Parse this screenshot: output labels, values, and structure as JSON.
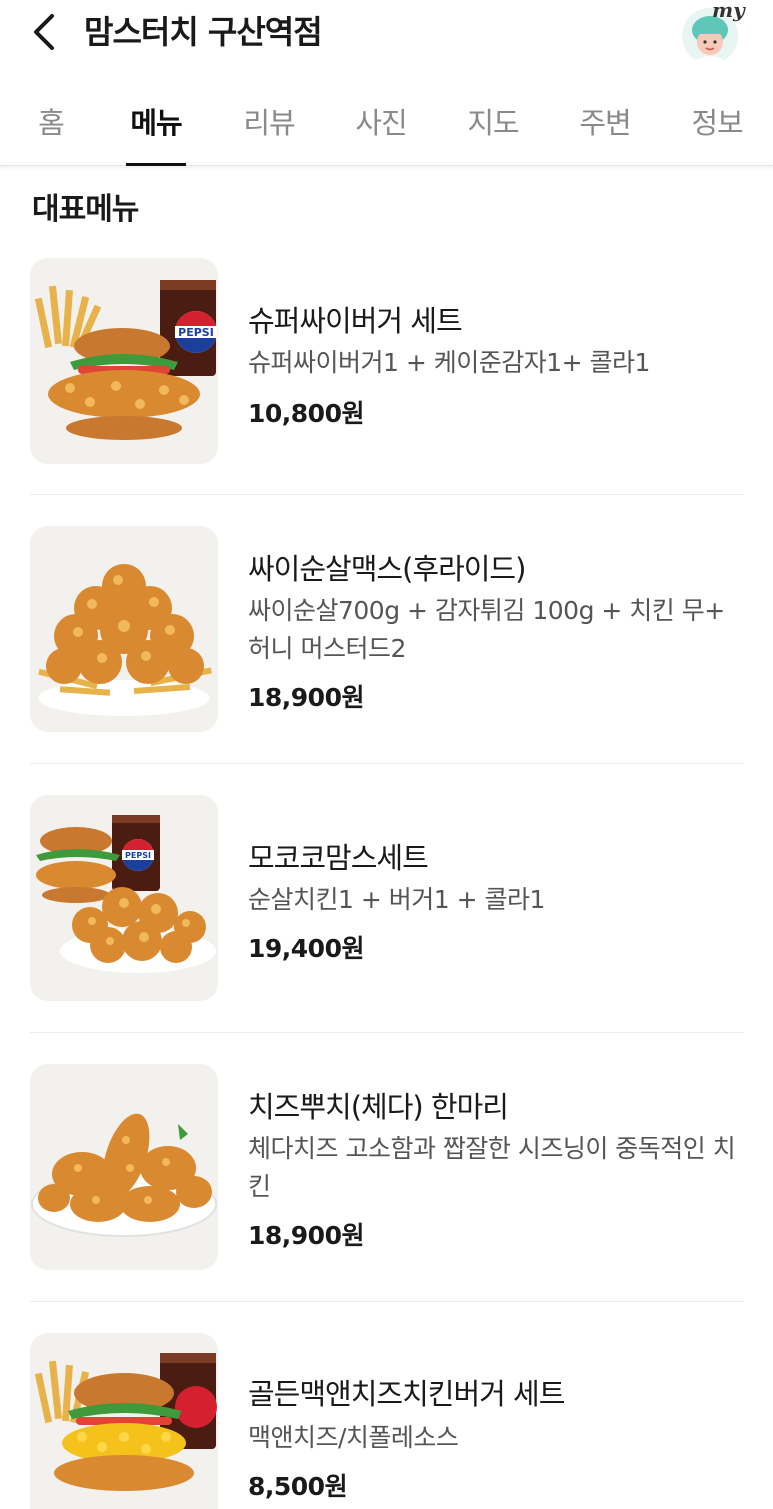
{
  "header": {
    "title": "맘스터치 구산역점",
    "avatar_badge": "my"
  },
  "tabs": [
    {
      "label": "홈",
      "active": false
    },
    {
      "label": "메뉴",
      "active": true
    },
    {
      "label": "리뷰",
      "active": false
    },
    {
      "label": "사진",
      "active": false
    },
    {
      "label": "지도",
      "active": false
    },
    {
      "label": "주변",
      "active": false
    },
    {
      "label": "정보",
      "active": false
    }
  ],
  "section_title": "대표메뉴",
  "menu": [
    {
      "name": "슈퍼싸이버거 세트",
      "desc": "슈퍼싸이버거1 + 케이준감자1+ 콜라1",
      "price": "10,800원",
      "image": "burger-set-image"
    },
    {
      "name": "싸이순살맥스(후라이드)",
      "desc": "싸이순살700g + 감자튀김 100g + 치킨 무+ 허니 머스터드2",
      "price": "18,900원",
      "image": "chicken-fries-image"
    },
    {
      "name": "모코코맘스세트",
      "desc": "순살치킨1 + 버거1 + 콜라1",
      "price": "19,400원",
      "image": "chicken-burger-set-image"
    },
    {
      "name": "치즈뿌치(체다) 한마리",
      "desc": "체다치즈 고소함과 짭잘한 시즈닝이 중독적인 치킨",
      "price": "18,900원",
      "image": "fried-chicken-plate-image"
    },
    {
      "name": "골든맥앤치즈치킨버거 세트",
      "desc": "맥앤치즈/치폴레소스",
      "price": "8,500원",
      "image": "mac-cheese-burger-set-image"
    }
  ],
  "colors": {
    "text": "#1a1a1a",
    "muted": "#8a8a8a",
    "desc": "#555555",
    "fried": "#d9892f",
    "bun": "#c9782f"
  }
}
